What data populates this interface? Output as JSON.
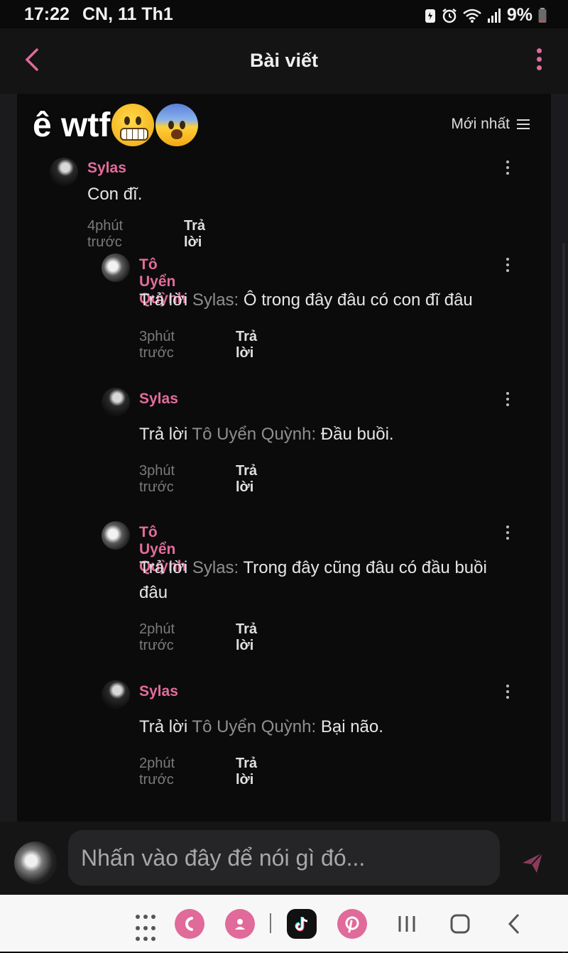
{
  "status_bar": {
    "time": "17:22",
    "date": "CN, 11 Th1",
    "battery": "9%"
  },
  "header": {
    "title": "Bài viết"
  },
  "overlay": {
    "text": "ê wtf"
  },
  "sort": {
    "label": "Mới nhất"
  },
  "comments": [
    {
      "author": "Sylas",
      "text": "Con đĩ.",
      "time": "4phút trước",
      "reply_label": "Trả lời"
    },
    {
      "author": "Tô Uyển Quỳnh",
      "prefix": "Trả lời ",
      "mention": "Sylas:",
      "text": " Ô trong đây đâu có con đĩ đâu",
      "time": "3phút trước",
      "reply_label": "Trả lời"
    },
    {
      "author": "Sylas",
      "prefix": "Trả lời ",
      "mention": "Tô Uyển Quỳnh:",
      "text": " Đầu buồi.",
      "time": "3phút trước",
      "reply_label": "Trả lời"
    },
    {
      "author": "Tô Uyển Quỳnh",
      "prefix": "Trả lời ",
      "mention": "Sylas:",
      "text": " Trong đây cũng đâu có đầu buồi đâu",
      "time": "2phút trước",
      "reply_label": "Trả lời"
    },
    {
      "author": "Sylas",
      "prefix": "Trả lời ",
      "mention": "Tô Uyển Quỳnh:",
      "text": " Bại não.",
      "time": "2phút trước",
      "reply_label": "Trả lời"
    }
  ],
  "input": {
    "placeholder": "Nhấn vào đây để nói gì đó..."
  },
  "colors": {
    "accent_pink": "#e46c9b",
    "background": "#0b0b0c"
  },
  "nav_icons": [
    "apps-grid-icon",
    "phone-app-icon",
    "contacts-app-icon",
    "tiktok-app-icon",
    "pinterest-app-icon",
    "recents-icon",
    "home-icon",
    "back-icon"
  ]
}
